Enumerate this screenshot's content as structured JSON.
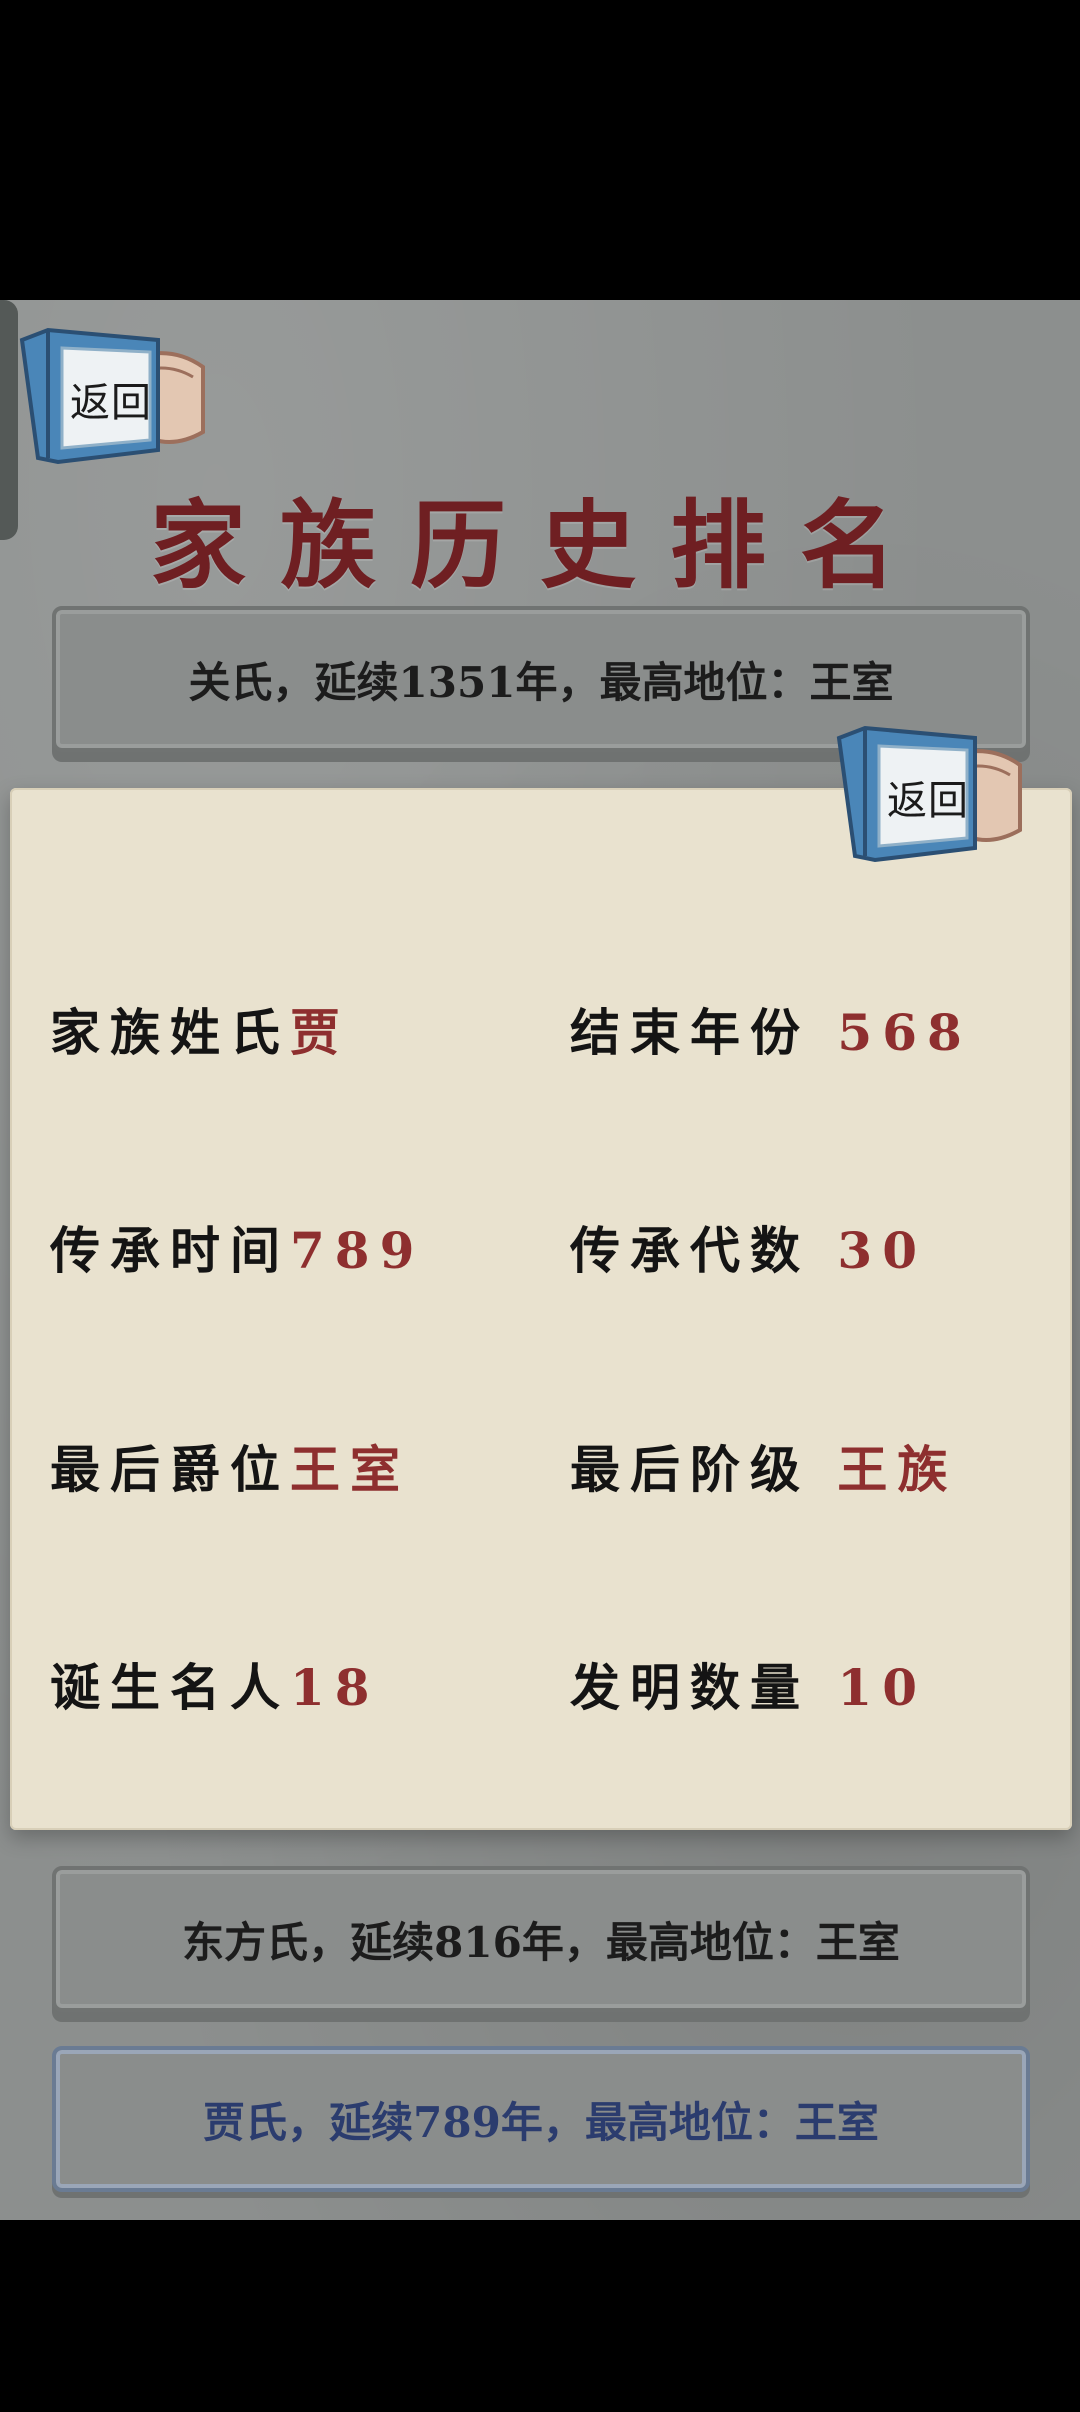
{
  "back_button": {
    "label": "返回",
    "icon": "book-icon"
  },
  "title": "家族历史排名",
  "rankings": [
    {
      "text": "关氏，延续1351年，最高地位：王室",
      "selected": false
    },
    {
      "text": "东方氏，延续816年，最高地位：王室",
      "selected": false
    },
    {
      "text": "贾氏，延续789年，最高地位：王室",
      "selected": true
    }
  ],
  "detail": {
    "back_label": "返回",
    "fields": [
      {
        "key": "家族姓氏",
        "value": "贾"
      },
      {
        "key": "结束年份",
        "value": "568"
      },
      {
        "key": "传承时间",
        "value": "789"
      },
      {
        "key": "传承代数",
        "value": "30"
      },
      {
        "key": "最后爵位",
        "value": "王室"
      },
      {
        "key": "最后阶级",
        "value": "王族"
      },
      {
        "key": "诞生名人",
        "value": "18"
      },
      {
        "key": "发明数量",
        "value": "10"
      }
    ]
  },
  "colors": {
    "title": "#6f1f22",
    "value": "#8e2f2f",
    "selected_text": "#2b3c6e",
    "paper": "#e9e2cf"
  }
}
